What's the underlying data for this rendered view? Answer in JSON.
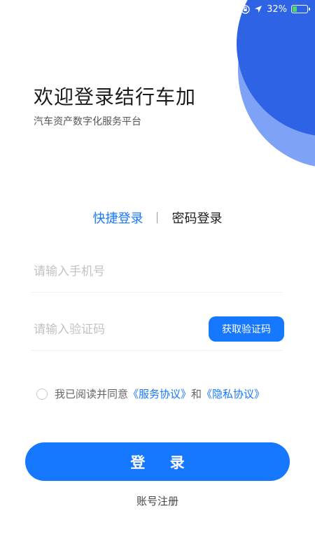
{
  "status_bar": {
    "battery_text": "32%",
    "battery_level": 0.32,
    "icons": [
      "orientation-lock-icon",
      "location-arrow-icon",
      "battery-charging-icon"
    ]
  },
  "header": {
    "title": "欢迎登录结行车加",
    "subtitle": "汽车资产数字化服务平台"
  },
  "tabs": [
    {
      "label": "快捷登录",
      "active": true
    },
    {
      "label": "密码登录",
      "active": false
    }
  ],
  "form": {
    "phone_placeholder": "请输入手机号",
    "phone_value": "",
    "code_placeholder": "请输入验证码",
    "code_value": "",
    "get_code_label": "获取验证码"
  },
  "agreement": {
    "prefix": "我已阅读并同意",
    "service_link": "《服务协议》",
    "conjunction": "和",
    "privacy_link": "《隐私协议》",
    "checked": false
  },
  "login_label": "登 录",
  "register_label": "账号注册",
  "colors": {
    "primary": "#1677ff",
    "deco_dark": "#2e63e6",
    "deco_light": "#7ea2f5",
    "battery_green": "#4cd964"
  }
}
